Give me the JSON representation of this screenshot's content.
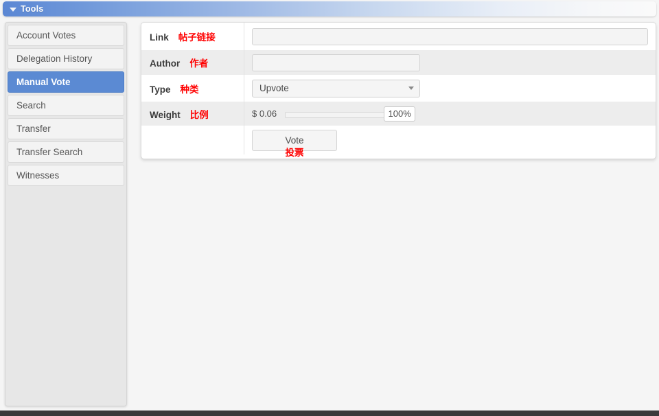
{
  "header": {
    "title": "Tools",
    "caret_icon": "chevron-down-icon",
    "gradient_start": "#5b87d4",
    "gradient_end": "#fafafa"
  },
  "sidebar": {
    "selected_color": "#5b8ad3",
    "items": [
      {
        "label": "Account Votes",
        "selected": false
      },
      {
        "label": "Delegation History",
        "selected": false
      },
      {
        "label": "Manual Vote",
        "selected": true
      },
      {
        "label": "Search",
        "selected": false
      },
      {
        "label": "Transfer",
        "selected": false
      },
      {
        "label": "Transfer Search",
        "selected": false
      },
      {
        "label": "Witnesses",
        "selected": false
      }
    ]
  },
  "form": {
    "annotation_color": "#ff0000",
    "rows": {
      "link": {
        "label": "Link",
        "label_cn": "帖子链接",
        "value": "",
        "placeholder": ""
      },
      "author": {
        "label": "Author",
        "label_cn": "作者",
        "value": "",
        "placeholder": ""
      },
      "type": {
        "label": "Type",
        "label_cn": "种类",
        "selected_option": "Upvote",
        "caret_icon": "chevron-down-icon"
      },
      "weight": {
        "label": "Weight",
        "label_cn": "比例",
        "amount": "$ 0.06",
        "percent": "100%",
        "slider_value": 100
      }
    },
    "submit": {
      "label": "Vote",
      "label_cn": "投票"
    }
  }
}
